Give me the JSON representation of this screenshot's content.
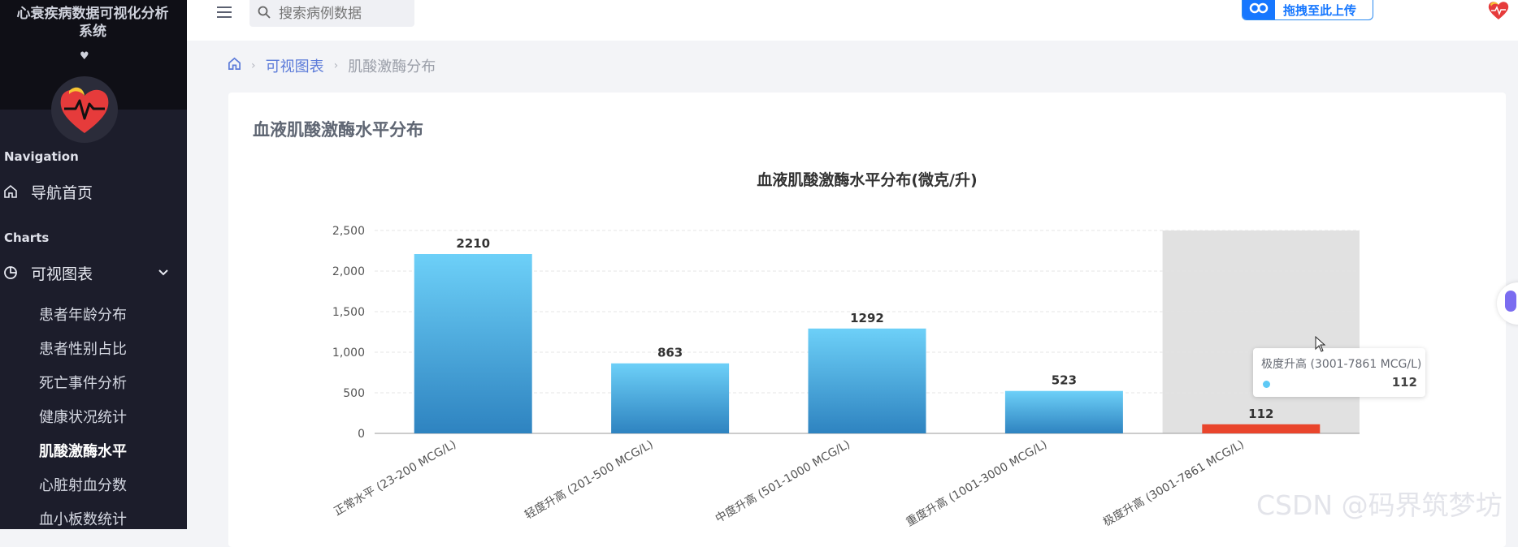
{
  "sidebar": {
    "title": "心衰疾病数据可视化分析系统",
    "sections": {
      "navigation": "Navigation",
      "charts": "Charts"
    },
    "home_label": "导航首页",
    "charts_label": "可视图表",
    "sub_items": [
      "患者年龄分布",
      "患者性别占比",
      "死亡事件分析",
      "健康状况统计",
      "肌酸激酶水平",
      "心脏射血分数",
      "血小板数统计"
    ],
    "active_index": 4
  },
  "topbar": {
    "search_placeholder": "搜索病例数据",
    "upload_label": "拖拽至此上传"
  },
  "breadcrumb": {
    "link": "可视图表",
    "current": "肌酸激酶分布"
  },
  "card": {
    "title": "血液肌酸激酶水平分布"
  },
  "chart_data": {
    "type": "bar",
    "title": "血液肌酸激酶水平分布(微克/升)",
    "categories": [
      "正常水平 (23-200 MCG/L)",
      "轻度升高 (201-500 MCG/L)",
      "中度升高 (501-1000 MCG/L)",
      "重度升高 (1001-3000 MCG/L)",
      "极度升高 (3001-7861 MCG/L)"
    ],
    "values": [
      2210,
      863,
      1292,
      523,
      112
    ],
    "ylim": [
      0,
      2500
    ],
    "yticks": [
      "0",
      "500",
      "1,000",
      "1,500",
      "2,000",
      "2,500"
    ],
    "xlabel": "",
    "ylabel": "",
    "grid": true,
    "colors": {
      "bar_top": "#6dd0f8",
      "bar_bottom": "#2e83c0",
      "highlight": "#e9452c",
      "hover_band": "#e1e1e1"
    },
    "highlight_index": 4,
    "tooltip": {
      "title": "极度升高 (3001-7861 MCG/L)",
      "value": "112"
    }
  },
  "watermark": "CSDN @码界筑梦坊"
}
